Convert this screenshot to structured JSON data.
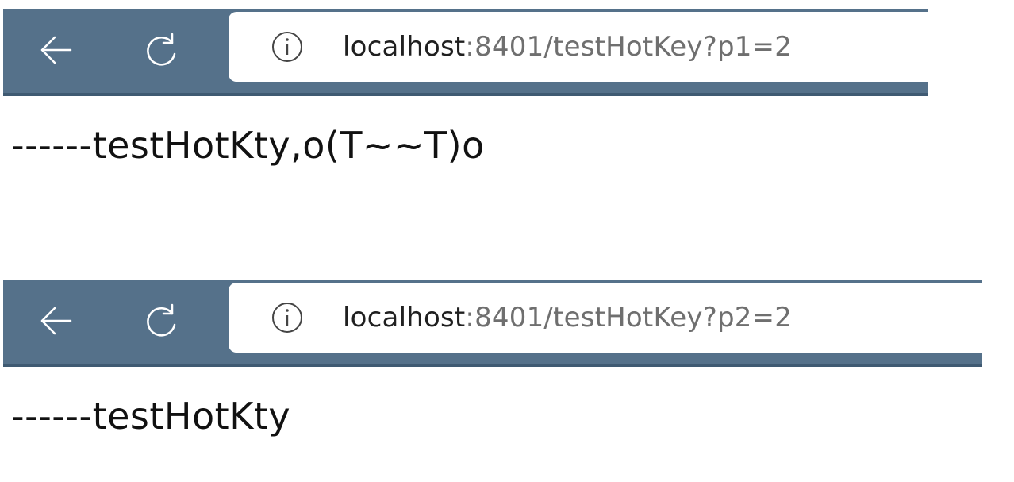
{
  "windows": [
    {
      "address_bar": {
        "host": "localhost",
        "rest": ":8401/testHotKey?p1=2"
      },
      "page": {
        "text": "------testHotKty,o(T~~T)o"
      }
    },
    {
      "address_bar": {
        "host": "localhost",
        "rest": ":8401/testHotKey?p2=2"
      },
      "page": {
        "text": "------testHotKty"
      }
    }
  ],
  "icons": {
    "back": "back-arrow-icon",
    "reload": "reload-icon",
    "info": "info-icon"
  },
  "colors": {
    "toolbar": "#55718a",
    "address_background": "#ffffff",
    "url_host": "#202020",
    "url_path": "#6f6f6f",
    "page_text": "#111111"
  }
}
